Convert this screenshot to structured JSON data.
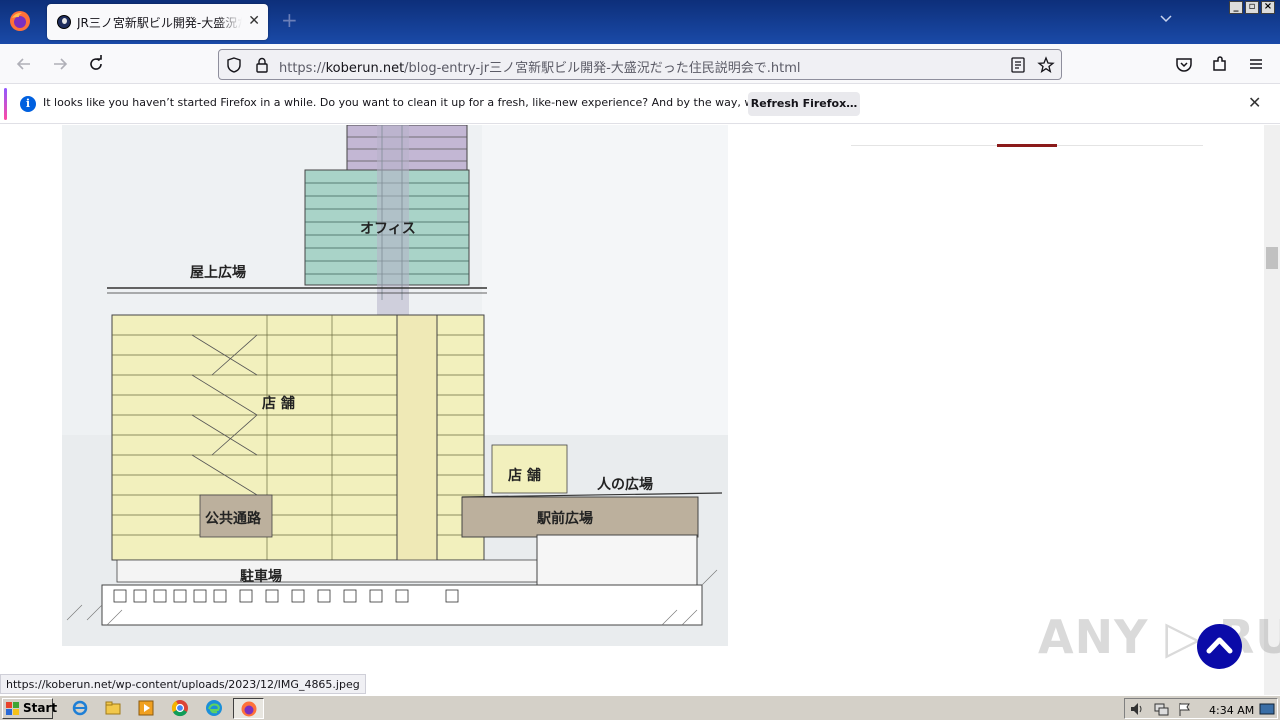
{
  "browser": {
    "tab_title": "JR三ノ宮新駅ビル開発-大盛況だった住民説明会で",
    "tab_close": "✕",
    "new_tab": "+",
    "url_prefix": "https://",
    "url_domain": "koberun.net",
    "url_path": "/blog-entry-jr三ノ宮新駅ビル開発-大盛況だった住民説明会で.html"
  },
  "notification": {
    "message": "It looks like you haven’t started Firefox in a while. Do you want to clean it up for a fresh, like-new experience? And by the way, welcome back!",
    "button_label": "Refresh Firefox…",
    "close": "✕"
  },
  "diagram": {
    "labels": {
      "office": "オフィス",
      "rooftop_plaza": "屋上広場",
      "shops_main": "店 舗",
      "shops_small": "店 舗",
      "people_plaza": "人の広場",
      "public_passage": "公共通路",
      "station_plaza": "駅前広場",
      "parking": "駐車場"
    },
    "colors": {
      "office": "#a9d3c8",
      "office_top": "#c3b7d4",
      "shops": "#f2f0bd",
      "plaza": "#bcb09d",
      "background": "#eef1f3"
    }
  },
  "status_bar": {
    "link_url": "https://koberun.net/wp-content/uploads/2023/12/IMG_4865.jpeg"
  },
  "watermark": {
    "text": "ANY ▷ RUN"
  },
  "taskbar": {
    "start_label": "Start",
    "clock": "4:34 AM"
  }
}
